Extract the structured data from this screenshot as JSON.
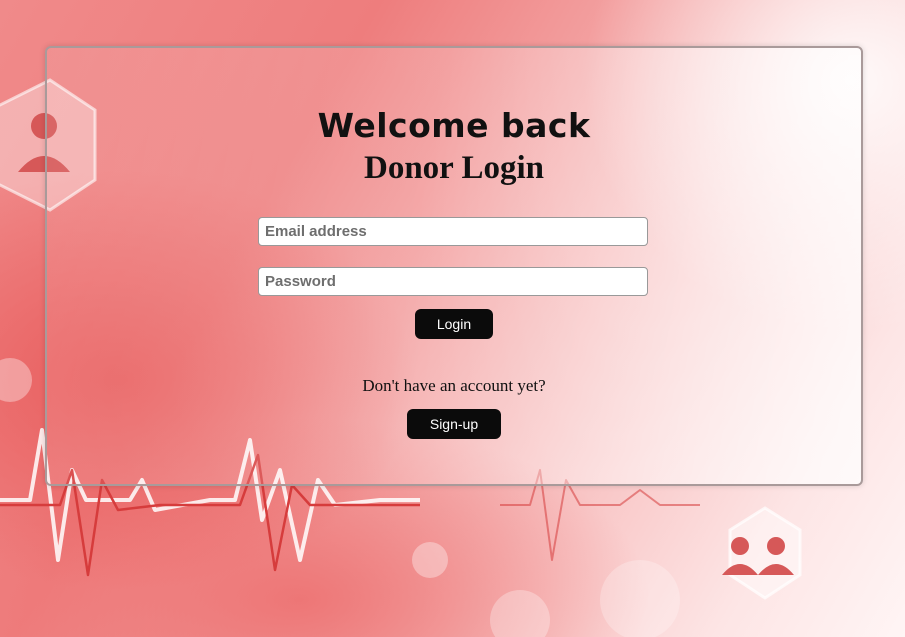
{
  "page": {
    "heading": "Welcome back",
    "subheading": "Donor Login"
  },
  "form": {
    "email_placeholder": "Email address",
    "email_value": "",
    "password_placeholder": "Password",
    "password_value": "",
    "login_label": "Login"
  },
  "signup": {
    "prompt": "Don't have an account yet?",
    "button_label": "Sign-up"
  },
  "colors": {
    "accent": "#e86a6a",
    "button_bg": "#0b0b0b",
    "button_text": "#ffffff"
  },
  "icons": [
    "people-icon",
    "person-icon",
    "heartbeat-line"
  ]
}
